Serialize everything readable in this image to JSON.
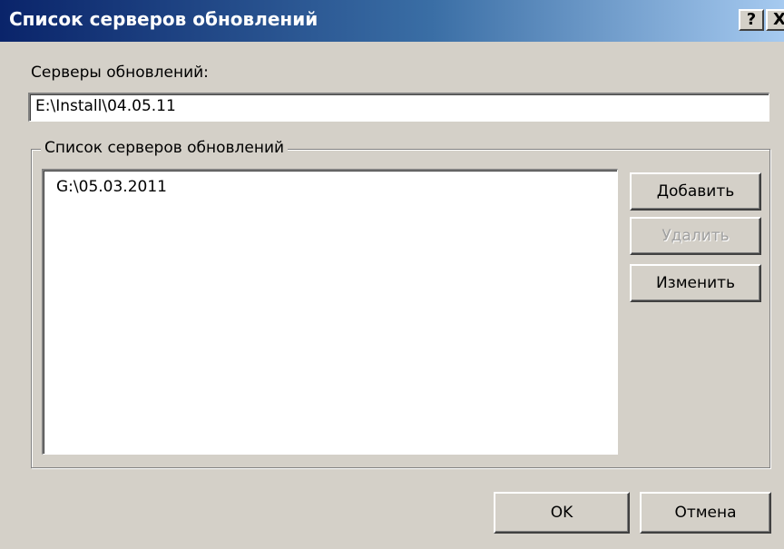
{
  "window": {
    "title": "Список серверов обновлений",
    "help_label": "?",
    "close_label": "X"
  },
  "servers": {
    "label": "Серверы обновлений:",
    "value": "E:\\Install\\04.05.11"
  },
  "group": {
    "legend": "Список серверов обновлений",
    "items": [
      {
        "label": "G:\\05.03.2011"
      }
    ]
  },
  "buttons": {
    "add": "Добавить",
    "delete": "Удалить",
    "edit": "Изменить",
    "ok": "OK",
    "cancel": "Отмена"
  },
  "state": {
    "delete_enabled": false
  },
  "colors": {
    "titlebar_start": "#0a246a",
    "titlebar_end": "#a6caf0",
    "face": "#d4d0c8",
    "disabled_text": "#a0a0a0"
  }
}
